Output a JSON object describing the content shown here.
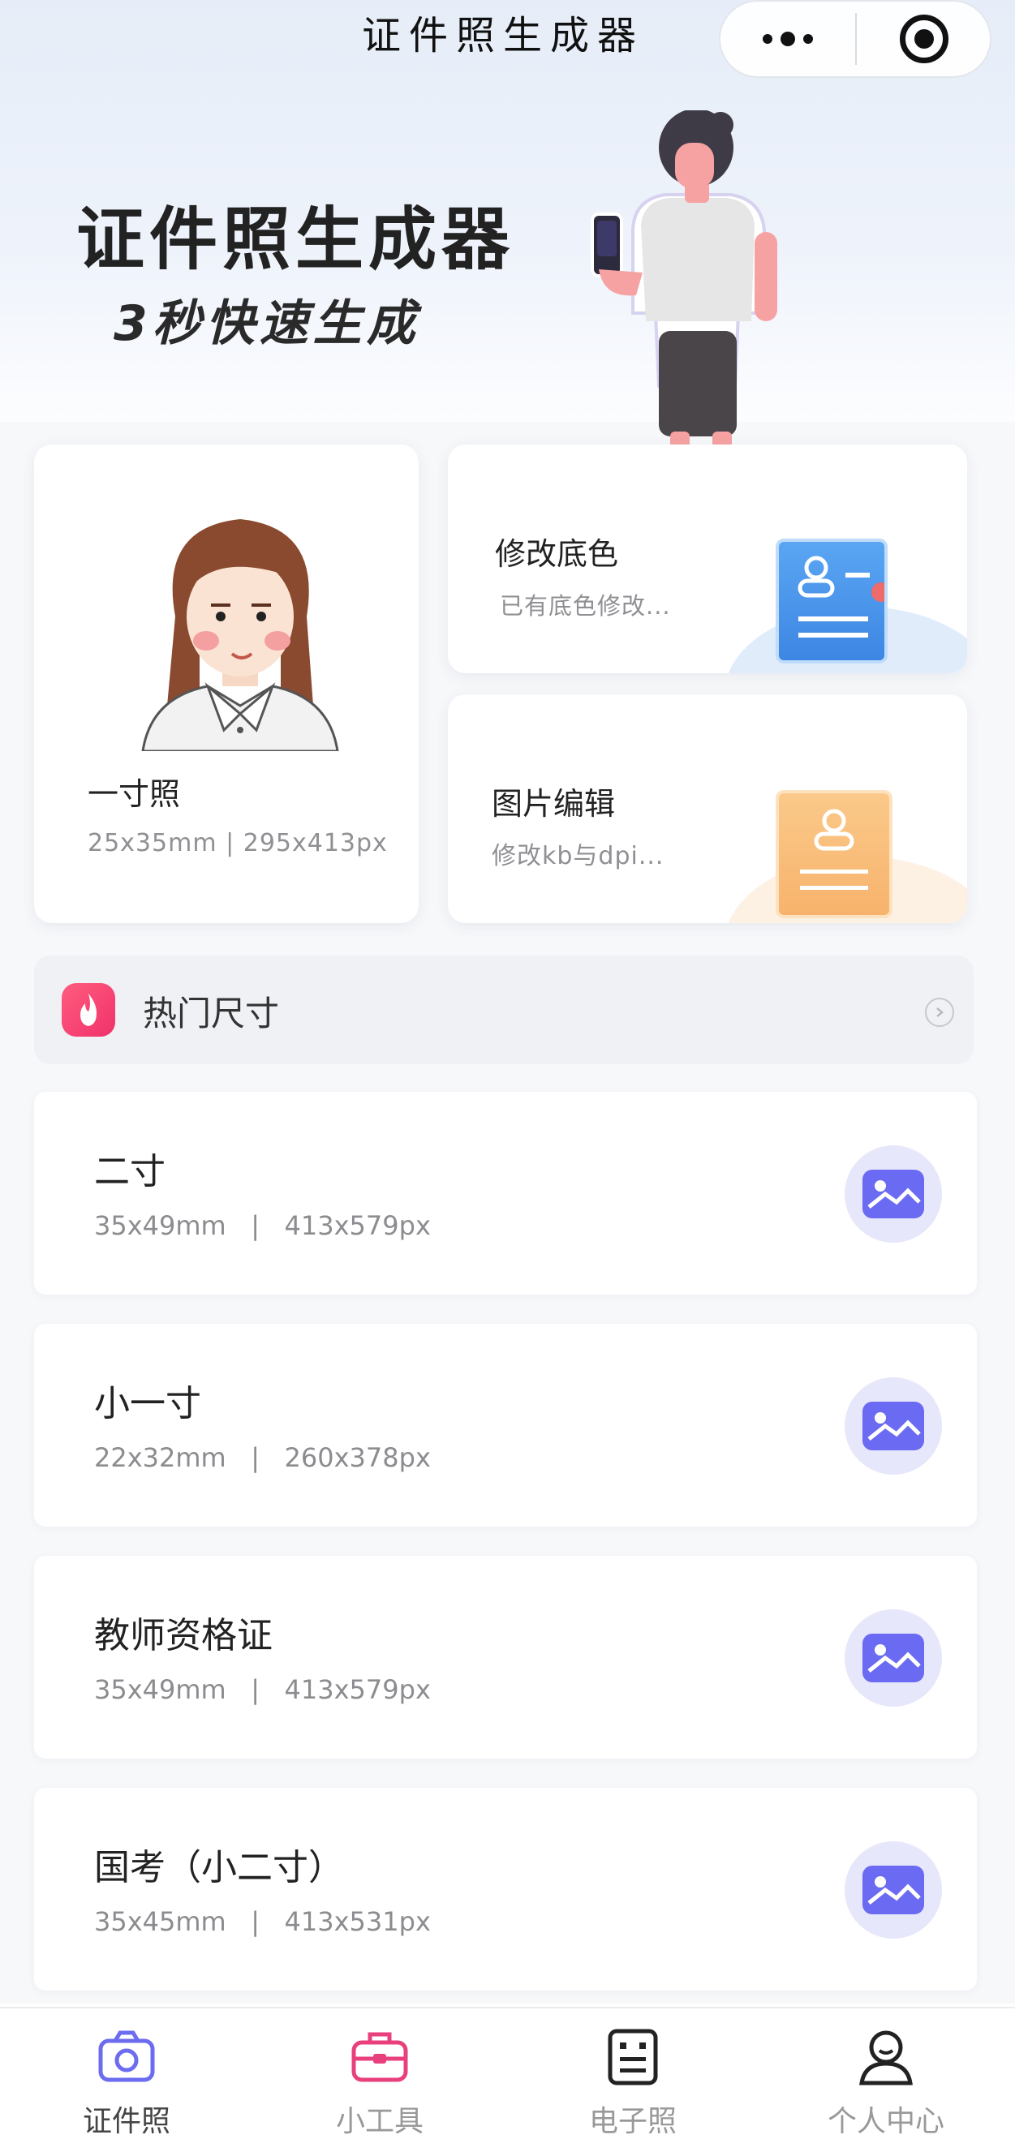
{
  "nav": {
    "title": "证件照生成器",
    "more_icon": "more-dots-icon",
    "close_icon": "target-close-icon"
  },
  "hero": {
    "title": "证件照生成器",
    "subtitle": "3秒快速生成"
  },
  "cards": {
    "main": {
      "title": "一寸照",
      "sub": "25x35mm | 295x413px"
    },
    "background": {
      "title": "修改底色",
      "sub": "已有底色修改..."
    },
    "edit": {
      "title": "图片编辑",
      "sub": "修改kb与dpi..."
    }
  },
  "hot": {
    "label": "热门尺寸",
    "icon": "fire-icon"
  },
  "sizes": [
    {
      "name": "二寸",
      "spec": "35x49mm   |   413x579px"
    },
    {
      "name": "小一寸",
      "spec": "22x32mm   |   260x378px"
    },
    {
      "name": "教师资格证",
      "spec": "35x49mm   |   413x579px"
    },
    {
      "name": "国考（小二寸）",
      "spec": "35x45mm   |   413x531px"
    }
  ],
  "tabs": [
    {
      "label": "证件照",
      "icon": "camera-icon"
    },
    {
      "label": "小工具",
      "icon": "toolbox-icon"
    },
    {
      "label": "电子照",
      "icon": "document-icon"
    },
    {
      "label": "个人中心",
      "icon": "user-icon"
    }
  ],
  "colors": {
    "accent": "#6c6cf0",
    "tool_accent": "#e8407c",
    "fire": "#f0316b"
  }
}
